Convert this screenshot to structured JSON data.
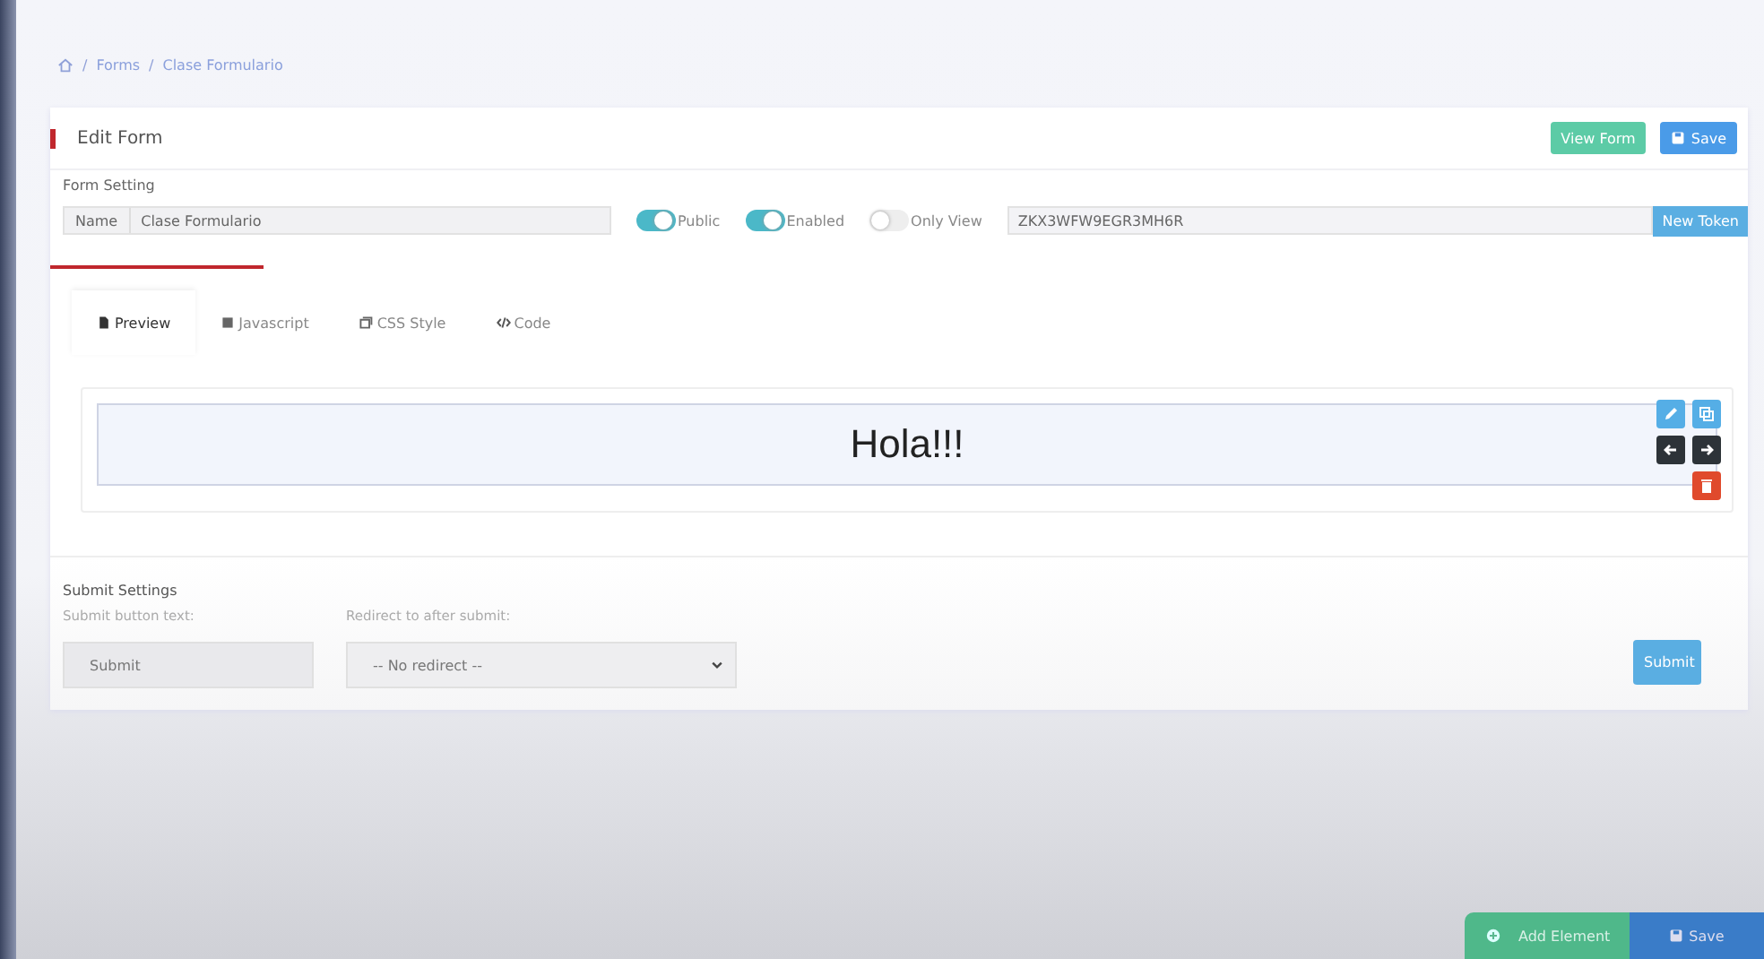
{
  "breadcrumb": {
    "separator": "/",
    "items": [
      "Forms",
      "Clase Formulario"
    ]
  },
  "header": {
    "title": "Edit Form",
    "buttons": [
      {
        "label": "View Form",
        "kind": "view"
      },
      {
        "label": "Save",
        "kind": "save"
      }
    ]
  },
  "form_setting": {
    "title": "Form Setting",
    "name_label": "Name",
    "name_value": "Clase Formulario",
    "toggles": [
      {
        "label": "Public",
        "on": true
      },
      {
        "label": "Enabled",
        "on": true
      },
      {
        "label": "Only View",
        "on": false
      }
    ],
    "token": "ZKX3WFW9EGR3MH6R",
    "token_button": "New Token"
  },
  "tabs": [
    {
      "label": "Preview",
      "selected": true,
      "kind": "file"
    },
    {
      "label": "Javascript",
      "selected": false,
      "kind": "js"
    },
    {
      "label": "CSS Style",
      "selected": false,
      "kind": "css"
    },
    {
      "label": "Code",
      "selected": false,
      "kind": "code"
    }
  ],
  "preview": {
    "heading": "Hola!!!"
  },
  "submit_settings": {
    "title": "Submit Settings",
    "button_text_label": "Submit button text:",
    "button_text_value": "Submit",
    "redirect_label": "Redirect to after submit:",
    "redirect_value": "-- No redirect --",
    "submit_button": "Submit"
  },
  "footer": {
    "add_button": "Add Element",
    "save_button": "Save"
  }
}
